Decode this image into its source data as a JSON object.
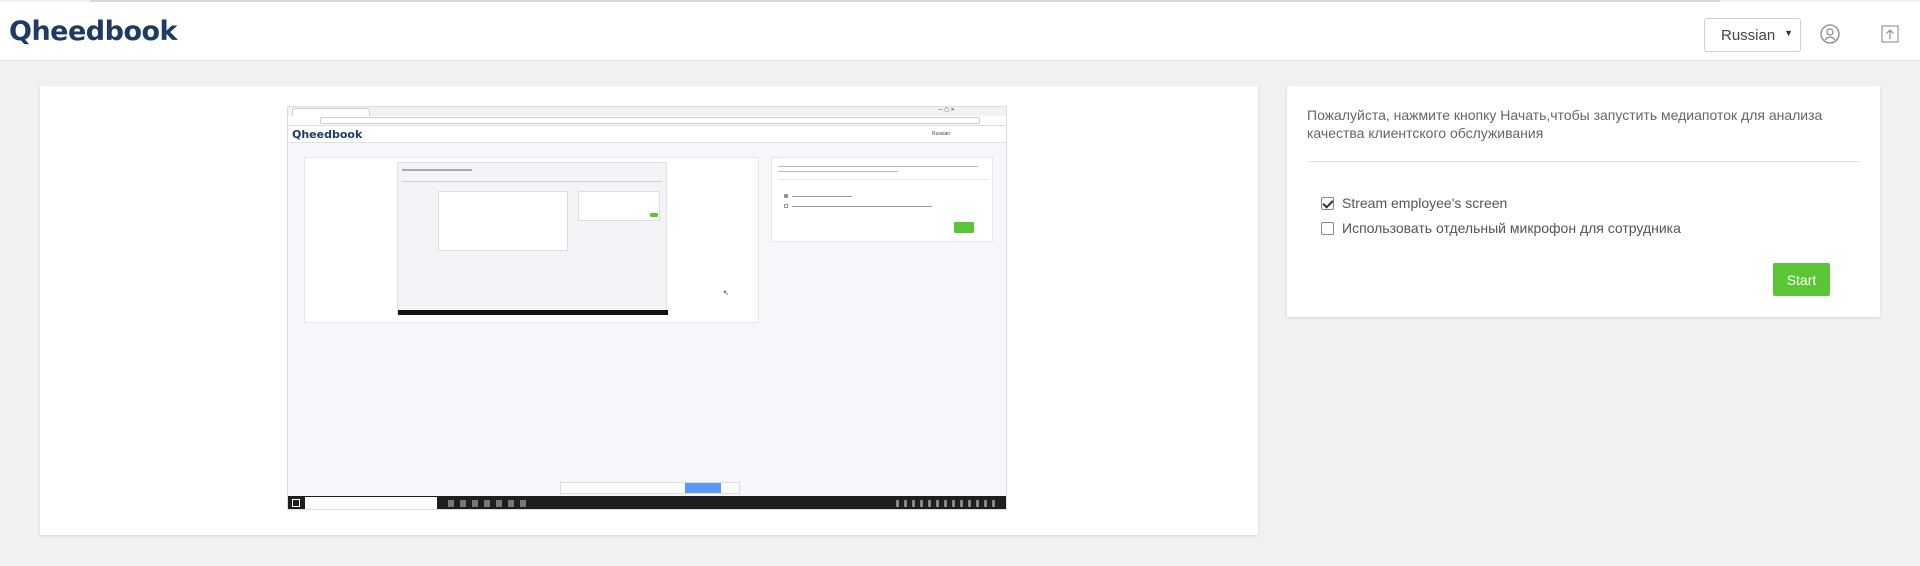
{
  "app": {
    "logo_text": "Qheedbook",
    "brand_color": "#1f3a64",
    "accent_color": "#5cc535"
  },
  "header": {
    "language_selected": "Russian",
    "icons": [
      "user-circle-icon",
      "upload-icon"
    ]
  },
  "panel": {
    "instruction": "Пожалуйста, нажмите кнопку Начать,чтобы запустить медиапоток для анализа качества клиентского обслуживания",
    "options": [
      {
        "label": "Stream employee's screen",
        "checked": true
      },
      {
        "label": "Использовать отдельный микрофон для сотрудника",
        "checked": false
      }
    ],
    "start_label": "Start"
  }
}
